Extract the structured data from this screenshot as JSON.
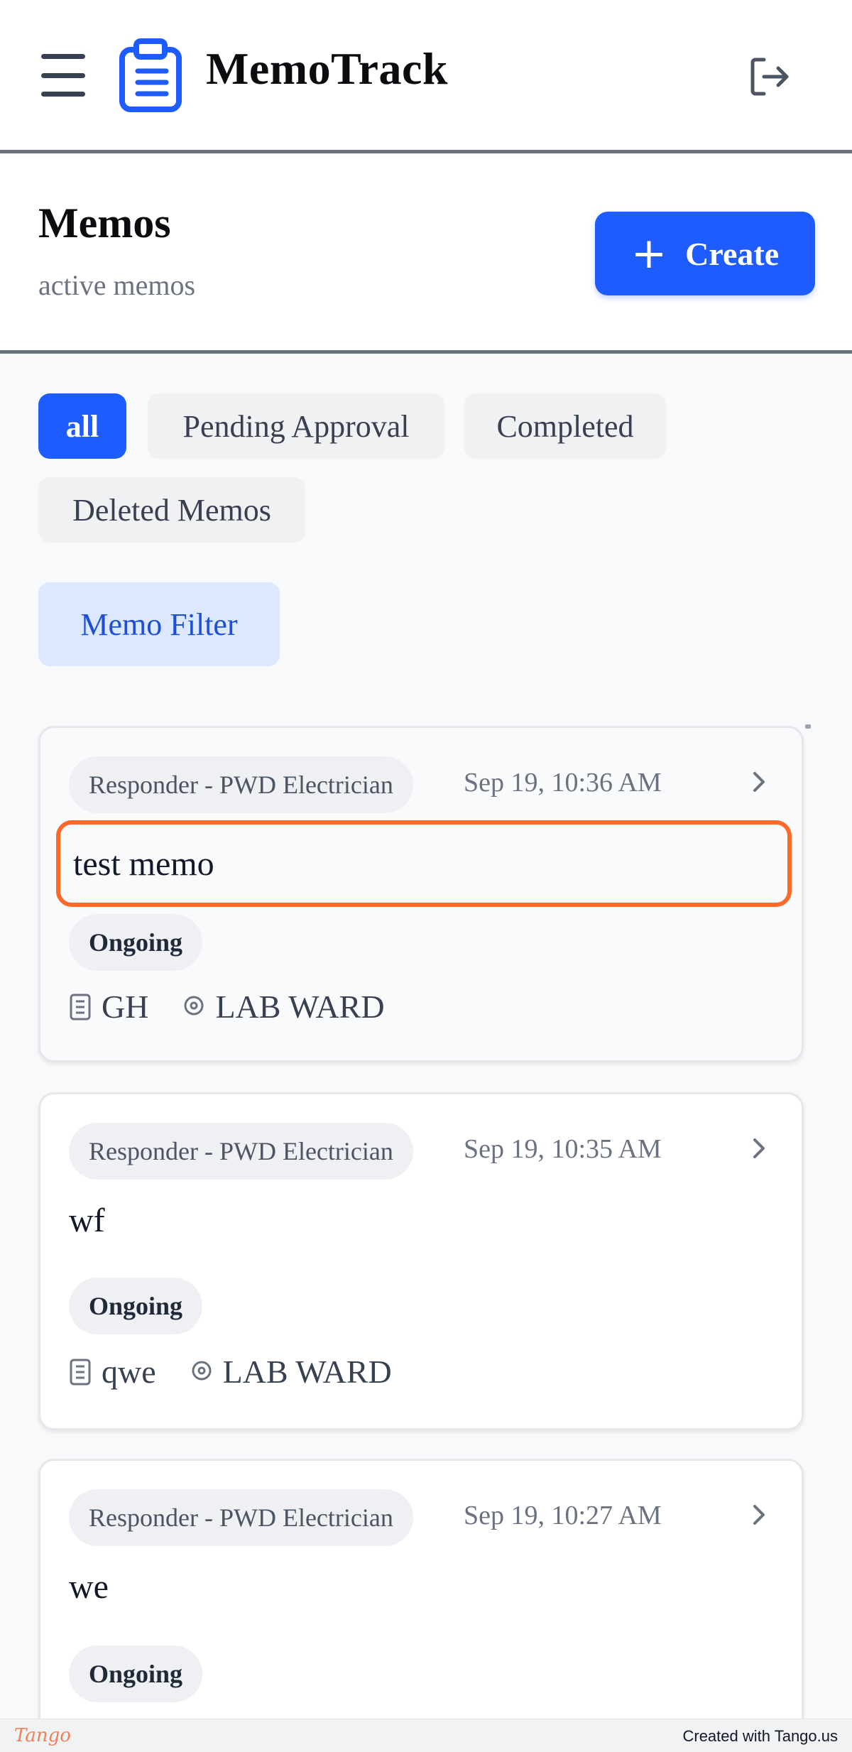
{
  "header": {
    "app_title": "MemoTrack",
    "menu_icon": "menu-icon",
    "logo_icon": "clipboard-list-icon",
    "logout_icon": "logout-icon"
  },
  "page": {
    "title": "Memos",
    "subtitle": "active memos",
    "create_label": "Create",
    "create_icon": "plus-icon"
  },
  "tabs": [
    {
      "label": "all",
      "active": true
    },
    {
      "label": "Pending Approval",
      "active": false
    },
    {
      "label": "Completed",
      "active": false
    },
    {
      "label": "Deleted Memos",
      "active": false
    }
  ],
  "memo_filter_label": "Memo Filter",
  "memos": [
    {
      "responder": "Responder - PWD Electrician",
      "date": "Sep 19, 10:36 AM",
      "title": "test memo",
      "status": "Ongoing",
      "building": "GH",
      "location": "LAB WARD",
      "highlighted": true
    },
    {
      "responder": "Responder - PWD Electrician",
      "date": "Sep 19, 10:35 AM",
      "title": "wf",
      "status": "Ongoing",
      "building": "qwe",
      "location": "LAB WARD",
      "highlighted": false
    },
    {
      "responder": "Responder - PWD Electrician",
      "date": "Sep 19, 10:27 AM",
      "title": "we",
      "status": "Ongoing",
      "highlighted": false
    }
  ],
  "footer": {
    "brand": "Tango",
    "created_with": "Created with Tango.us"
  },
  "colors": {
    "primary": "#1f5cff",
    "highlight_border": "#ff6a2b",
    "filter_bg": "#dbe8ff"
  }
}
